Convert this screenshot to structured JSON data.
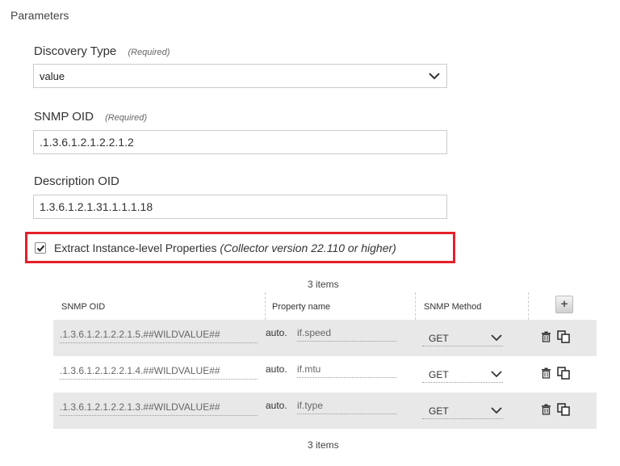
{
  "section_title": "Parameters",
  "discovery_type": {
    "label": "Discovery Type",
    "required": "(Required)",
    "value": "value"
  },
  "snmp_oid": {
    "label": "SNMP OID",
    "required": "(Required)",
    "value": ".1.3.6.1.2.1.2.2.1.2"
  },
  "description_oid": {
    "label": "Description OID",
    "value": "1.3.6.1.2.1.31.1.1.1.18"
  },
  "extract": {
    "checked": true,
    "label": "Extract Instance-level Properties",
    "note": "(Collector version 22.110 or higher)"
  },
  "table": {
    "count_top": "3 items",
    "count_bottom": "3 items",
    "columns": [
      "SNMP OID",
      "Property name",
      "SNMP Method"
    ],
    "rows": [
      {
        "oid": ".1.3.6.1.2.1.2.2.1.5.##WILDVALUE##",
        "prefix": "auto.",
        "property": "if.speed",
        "method": "GET"
      },
      {
        "oid": ".1.3.6.1.2.1.2.2.1.4.##WILDVALUE##",
        "prefix": "auto.",
        "property": "if.mtu",
        "method": "GET"
      },
      {
        "oid": ".1.3.6.1.2.1.2.2.1.3.##WILDVALUE##",
        "prefix": "auto.",
        "property": "if.type",
        "method": "GET"
      }
    ]
  },
  "icons": {
    "dropdown": "chevron-down-icon",
    "add": "plus-icon",
    "delete": "trash-icon",
    "duplicate": "copy-icon",
    "check": "check-icon"
  },
  "colors": {
    "highlight_border": "#e3202a",
    "row_shade": "#e8e8e8"
  }
}
